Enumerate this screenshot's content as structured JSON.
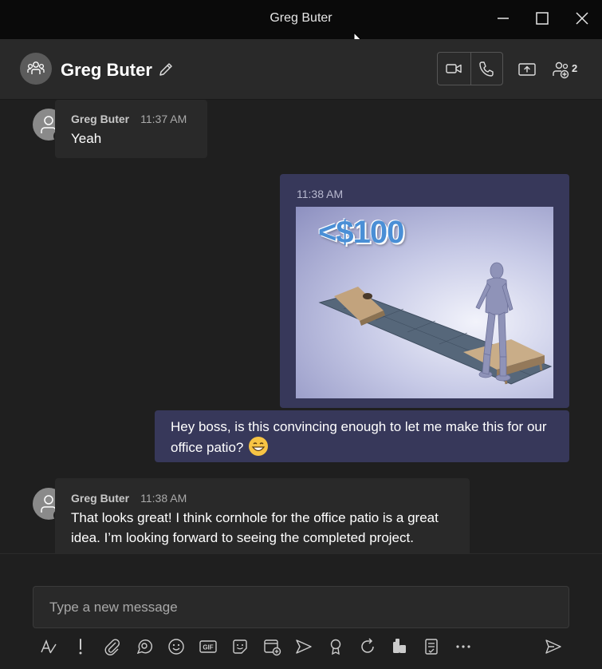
{
  "window": {
    "title": "Greg Buter"
  },
  "header": {
    "chat_name": "Greg Buter",
    "participant_count": "2"
  },
  "messages": [
    {
      "sender": "Greg Buter",
      "time": "11:37 AM",
      "text": "Yeah",
      "status_color": "#c4314b"
    },
    {
      "time": "11:38 AM",
      "image_caption": "<$100"
    },
    {
      "text": "Hey boss, is this convincing enough to let me make this for our office patio? ",
      "emoji": "grinning-face-emoji"
    },
    {
      "sender": "Greg Buter",
      "time": "11:38 AM",
      "text": "That looks great! I think cornhole for the office patio is a great idea. I’m looking forward to seeing the completed project.",
      "status_color": "#c4314b"
    }
  ],
  "composer": {
    "placeholder": "Type a new message",
    "tools": [
      "format-icon",
      "priority-icon",
      "attach-icon",
      "loop-icon",
      "emoji-icon",
      "gif-icon",
      "sticker-icon",
      "schedule-meeting-icon",
      "stream-icon",
      "praise-icon",
      "refresh-icon",
      "apps-icon",
      "approvals-icon",
      "more-options-icon"
    ]
  },
  "colors": {
    "accent_out": "#37385a",
    "background": "#1f1f1f",
    "status_busy": "#c4314b"
  }
}
